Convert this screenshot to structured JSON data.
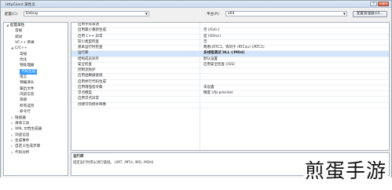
{
  "window": {
    "title": "HttpClient 属性页",
    "help_btn": "?",
    "close_btn": "✕"
  },
  "config": {
    "config_label": "配置(C):",
    "config_value": "Debug",
    "platform_label": "平台(P):",
    "platform_value": "x64",
    "manager_button": "配置管理器(O)..."
  },
  "tree": {
    "items": [
      {
        "label": "配置属性",
        "indent": 0,
        "expand": "◢"
      },
      {
        "label": "常规",
        "indent": 1,
        "expand": ""
      },
      {
        "label": "调试",
        "indent": 1,
        "expand": ""
      },
      {
        "label": "VC++ 目录",
        "indent": 1,
        "expand": ""
      },
      {
        "label": "C/C++",
        "indent": 1,
        "expand": "◢"
      },
      {
        "label": "常规",
        "indent": 2,
        "expand": ""
      },
      {
        "label": "优化",
        "indent": 2,
        "expand": ""
      },
      {
        "label": "预处理器",
        "indent": 2,
        "expand": ""
      },
      {
        "label": "代码生成",
        "indent": 2,
        "expand": "",
        "selected": true
      },
      {
        "label": "语言",
        "indent": 2,
        "expand": ""
      },
      {
        "label": "预编译头",
        "indent": 2,
        "expand": ""
      },
      {
        "label": "输出文件",
        "indent": 2,
        "expand": ""
      },
      {
        "label": "浏览信息",
        "indent": 2,
        "expand": ""
      },
      {
        "label": "高级",
        "indent": 2,
        "expand": ""
      },
      {
        "label": "所有选项",
        "indent": 2,
        "expand": ""
      },
      {
        "label": "命令行",
        "indent": 2,
        "expand": ""
      },
      {
        "label": "链接器",
        "indent": 1,
        "expand": "▷"
      },
      {
        "label": "清单工具",
        "indent": 1,
        "expand": "▷"
      },
      {
        "label": "XML 文档生成器",
        "indent": 1,
        "expand": "▷"
      },
      {
        "label": "浏览信息",
        "indent": 1,
        "expand": "▷"
      },
      {
        "label": "生成事件",
        "indent": 1,
        "expand": "▷"
      },
      {
        "label": "自定义生成步骤",
        "indent": 1,
        "expand": "▷"
      },
      {
        "label": "代码分析",
        "indent": 1,
        "expand": "▷"
      }
    ]
  },
  "grid": {
    "rows": [
      {
        "name": "启用字符串池",
        "value": ""
      },
      {
        "name": "启用最小重新生成",
        "value": "否 (/Gm-)"
      },
      {
        "name": "启用 C++ 异常",
        "value": "是 (/EHsc)"
      },
      {
        "name": "较小类型检查",
        "value": "否"
      },
      {
        "name": "基本运行时检查",
        "value": "两者(/RTC1，等同于 /RTCsu) (/RTC1)"
      },
      {
        "name": "运行库",
        "value": "多线程调试 DLL (/MDd)",
        "bold": true,
        "selected": true
      },
      {
        "name": "结构成员对齐",
        "value": "默认设置"
      },
      {
        "name": "安全检查",
        "value": "启用安全检查 (/GS)"
      },
      {
        "name": "控制流防护",
        "value": ""
      },
      {
        "name": "启用函数级链接",
        "value": ""
      },
      {
        "name": "启用并行代码生成",
        "value": ""
      },
      {
        "name": "启用增强指令集",
        "value": "未设置"
      },
      {
        "name": "浮点模型",
        "value": "精度 (/fp:precise)"
      },
      {
        "name": "启用浮点异常",
        "value": ""
      },
      {
        "name": "创建可热修补映像",
        "value": ""
      }
    ]
  },
  "description": {
    "title": "运行库",
    "text": "指定运行时库以进行链接。 (/MT, /MTd, /MD, /MDd)"
  },
  "watermark": {
    "text": "煎蛋手游"
  }
}
